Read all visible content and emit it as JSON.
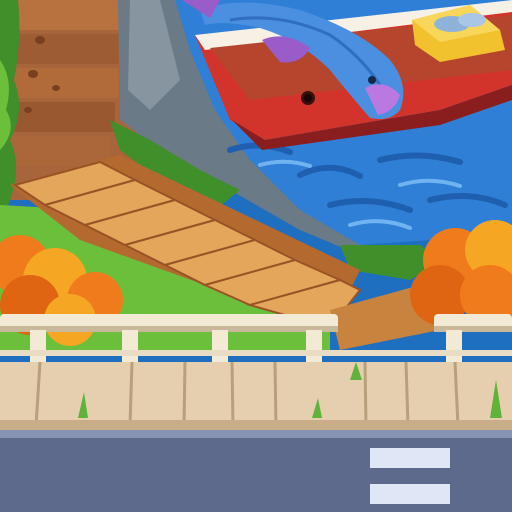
{
  "scene": {
    "kind": "game-background",
    "elements": [
      "wooden-stairs",
      "rock-cliff",
      "river-water",
      "red-boat",
      "blue-fish",
      "fish-crate",
      "autumn-bushes",
      "stone-railing",
      "sidewalk",
      "road"
    ]
  },
  "colors": {
    "water": "#2f7fd6",
    "water_dark": "#1f5fb0",
    "boat_red": "#d2342c",
    "boat_dark": "#8a1d1d",
    "fish_blue": "#4a8fe0",
    "fish_fin": "#9a5cc8",
    "crate_yellow": "#f2c12e",
    "wood_light": "#e3a65a",
    "wood_dark": "#b46a2e",
    "wall_wood": "#a8643a",
    "grass": "#6cbf3a",
    "grass_dark": "#3f8f2a",
    "rock": "#6a7a86",
    "bush_orange": "#f07b1c",
    "bush_yellow": "#f5a623",
    "railing": "#f3ead6",
    "railing_shadow": "#c9b99a",
    "sidewalk": "#e6cfae",
    "road": "#5d6a8c",
    "road_line": "#dfe6f5"
  }
}
